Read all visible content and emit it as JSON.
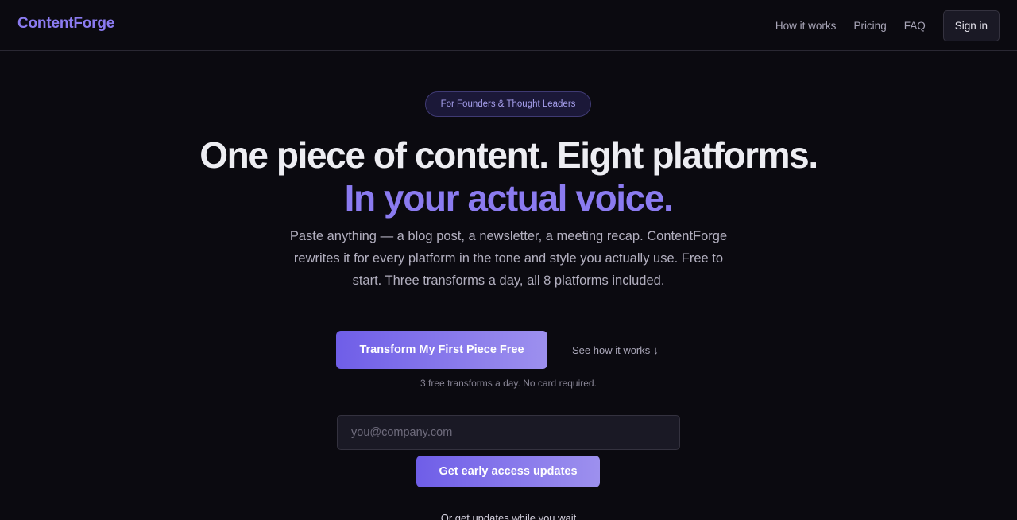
{
  "nav": {
    "logo": "ContentForge",
    "links": [
      "How it works",
      "Pricing",
      "FAQ"
    ],
    "signin_label": "Sign in"
  },
  "hero": {
    "badge": "For Founders & Thought Leaders",
    "headline_main": "One piece of content. Eight platforms.",
    "headline_accent": "In your actual voice.",
    "subtext": "Paste anything — a blog post, a newsletter, a meeting recap. ContentForge rewrites it for every platform in the tone and style you actually use. Free to start. Three transforms a day, all 8 platforms included.",
    "cta_label": "Transform My First Piece Free",
    "secondary_label": "See how it works",
    "secondary_arrow": "↓",
    "note": "3 free transforms a day. No card required."
  },
  "signup": {
    "email_placeholder": "you@company.com",
    "button_label": "Get early access updates",
    "footer_text": "Or get updates while you wait"
  },
  "colors": {
    "background": "#0b0a10",
    "accent": "#8b7bf0",
    "button_gradient_start": "#6f5ee8",
    "button_gradient_end": "#9d90ee"
  }
}
